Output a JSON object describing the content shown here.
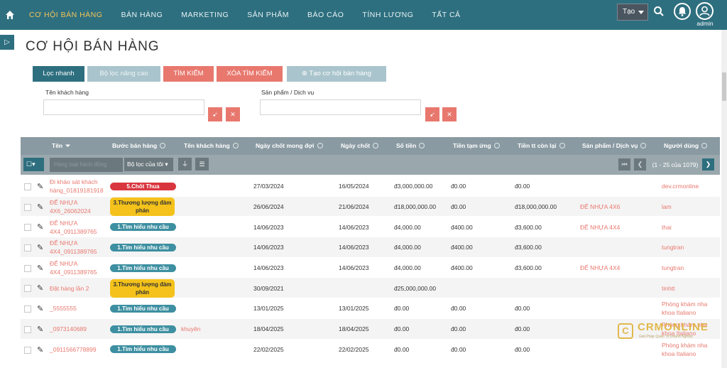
{
  "nav": {
    "items": [
      "CƠ HỘI BÁN HÀNG",
      "BÁN HÀNG",
      "MARKETING",
      "SẢN PHẨM",
      "BÁO CÁO",
      "TÍNH LƯƠNG",
      "TẤT CẢ"
    ],
    "create_label": "Tạo",
    "user_label": "admin"
  },
  "page": {
    "title": "CƠ HỘI BÁN HÀNG"
  },
  "tabs": {
    "quick": "Lọc nhanh",
    "advanced": "Bộ lọc nâng cao",
    "search": "TÌM KIẾM",
    "clear": "XÓA TÌM KIẾM",
    "create": "Tạo cơ hội bán hàng"
  },
  "filters": {
    "customer_label": "Tên khách hàng",
    "product_label": "Sản phẩm / Dịch vụ"
  },
  "columns": [
    "Tên",
    "Bước bán hàng",
    "Tên khách hàng",
    "Ngày chốt mong đợi",
    "Ngày chốt",
    "Số tiền",
    "Tiền tạm ứng",
    "Tiền tt còn lại",
    "Sản phẩm / Dịch vụ",
    "Người dùng"
  ],
  "toolbar": {
    "bulk_placeholder": "Hàng loạt hành động",
    "my_filter": "Bộ lọc của tôi",
    "pagination": "(1 - 25 của 1079)"
  },
  "rows": [
    {
      "name": "Đi khảo sát khách hàng_01819181918",
      "stage": "5.Chốt Thua",
      "stage_type": "red",
      "customer": "",
      "expected": "27/03/2024",
      "closed": "16/05/2024",
      "amount": "đ3,000,000.00",
      "advance": "đ0.00",
      "remaining": "đ0.00",
      "product": "",
      "user": "dev.crmonline"
    },
    {
      "name": "ĐẾ NHỰA 4X6_26062024",
      "stage": "3.Thương lượng đàm phán",
      "stage_type": "yellow",
      "customer": "",
      "expected": "26/06/2024",
      "closed": "21/06/2024",
      "amount": "đ18,000,000.00",
      "advance": "đ0.00",
      "remaining": "đ18,000,000.00",
      "product": "ĐẾ NHỰA 4X6",
      "user": "lam"
    },
    {
      "name": "ĐẾ NHỰA 4X4_0911389765",
      "stage": "1.Tìm hiểu nhu cầu",
      "stage_type": "teal",
      "customer": "",
      "expected": "14/06/2023",
      "closed": "14/06/2023",
      "amount": "đ4,000.00",
      "advance": "đ400.00",
      "remaining": "đ3,600.00",
      "product": "ĐẾ NHỰA 4X4",
      "user": "thai"
    },
    {
      "name": "ĐẾ NHỰA 4X4_0911389765",
      "stage": "1.Tìm hiểu nhu cầu",
      "stage_type": "teal",
      "customer": "",
      "expected": "14/06/2023",
      "closed": "14/06/2023",
      "amount": "đ4,000.00",
      "advance": "đ400.00",
      "remaining": "đ3,600.00",
      "product": "",
      "user": "tungtran"
    },
    {
      "name": "ĐẾ NHỰA 4X4_0911389765",
      "stage": "1.Tìm hiểu nhu cầu",
      "stage_type": "teal",
      "customer": "",
      "expected": "14/06/2023",
      "closed": "14/06/2023",
      "amount": "đ4,000.00",
      "advance": "đ400.00",
      "remaining": "đ3,600.00",
      "product": "ĐẾ NHỰA 4X4",
      "user": "tungtran"
    },
    {
      "name": "Đặt hàng lần 2",
      "stage": "3.Thương lượng đàm phán",
      "stage_type": "yellow",
      "customer": "",
      "expected": "30/09/2021",
      "closed": "",
      "amount": "đ25,000,000.00",
      "advance": "",
      "remaining": "",
      "product": "",
      "user": "tinhtt"
    },
    {
      "name": "_5555555",
      "stage": "1.Tìm hiểu nhu cầu",
      "stage_type": "teal",
      "customer": "",
      "expected": "13/01/2025",
      "closed": "13/01/2025",
      "amount": "đ0.00",
      "advance": "đ0.00",
      "remaining": "đ0.00",
      "product": "",
      "user": "Phòng khám nha khoa Italiano"
    },
    {
      "name": "_0973140689",
      "stage": "1.Tìm hiểu nhu cầu",
      "stage_type": "teal",
      "customer": "khuyên",
      "expected": "18/04/2025",
      "closed": "18/04/2025",
      "amount": "đ0.00",
      "advance": "đ0.00",
      "remaining": "đ0.00",
      "product": "",
      "user": "Phòng khám nha khoa Italiano"
    },
    {
      "name": "_0911566778899",
      "stage": "1.Tìm hiểu nhu cầu",
      "stage_type": "teal",
      "customer": "",
      "expected": "22/02/2025",
      "closed": "22/02/2025",
      "amount": "đ0.00",
      "advance": "đ0.00",
      "remaining": "đ0.00",
      "product": "",
      "user": "Phòng khám nha khoa Italiano"
    }
  ],
  "watermark": {
    "brand": "CRMONLINE",
    "tagline": "Giải Pháp Quản Trị Doanh Nghiệp"
  },
  "colors": {
    "primary": "#2e6f7f",
    "accent": "#e8786e",
    "nav_active": "#f2c45a"
  }
}
